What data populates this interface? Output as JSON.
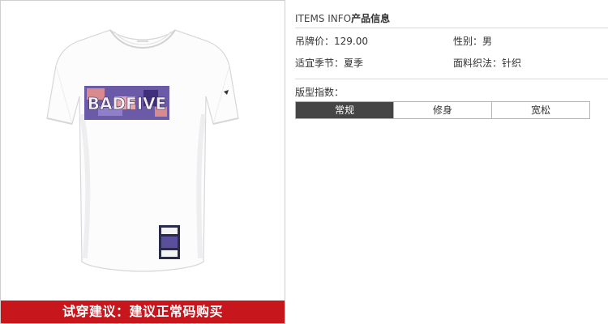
{
  "product": {
    "image_alt": "white t-shirt",
    "chest_print": "BADFIVE",
    "fit_banner": "试穿建议：建议正常码购买"
  },
  "info": {
    "header_en": "ITEMS INFO",
    "header_cn": "产品信息",
    "attributes": [
      {
        "label": "吊牌价：",
        "value": "129.00"
      },
      {
        "label": "性别：",
        "value": "男"
      },
      {
        "label": "适宜季节：",
        "value": "夏季"
      },
      {
        "label": "面料织法：",
        "value": "针织"
      }
    ],
    "fit_title": "版型指数：",
    "fit_options": [
      {
        "label": "常规",
        "selected": true
      },
      {
        "label": "修身",
        "selected": false
      },
      {
        "label": "宽松",
        "selected": false
      }
    ]
  },
  "colors": {
    "banner_red": "#c8161d",
    "selected_fit": "#454545",
    "print_purple": "#6b5aa8"
  }
}
